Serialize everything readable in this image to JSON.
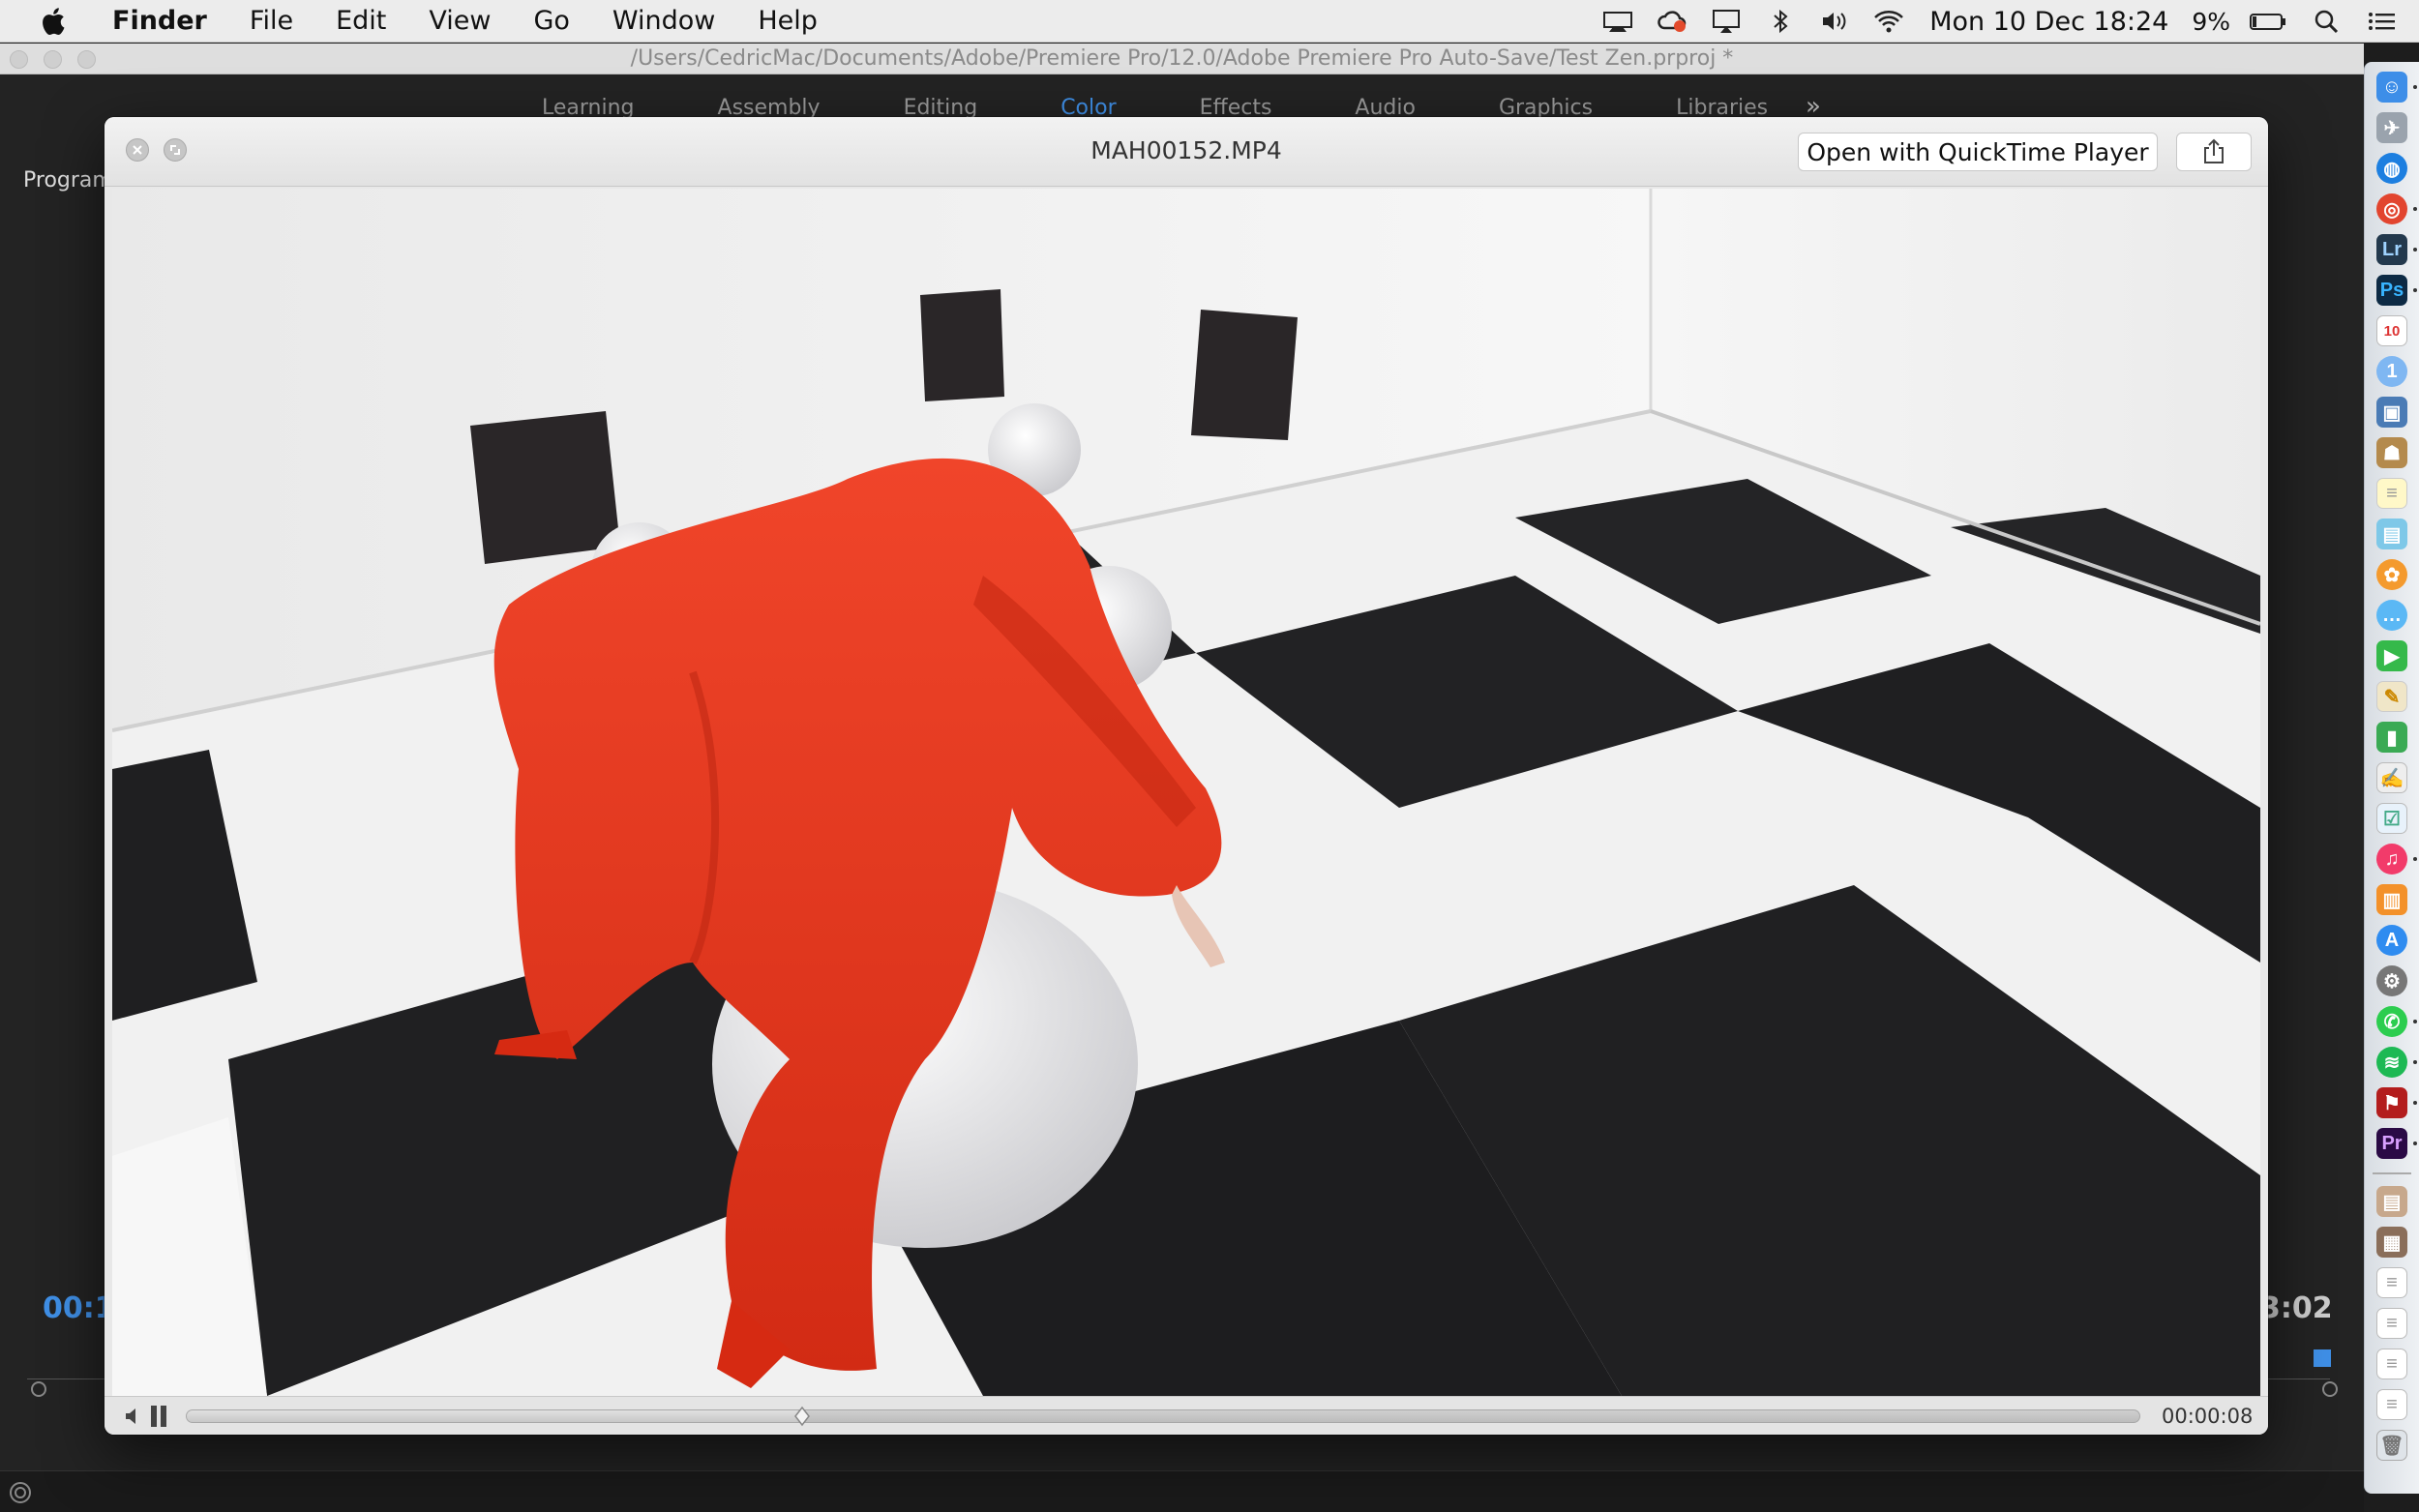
{
  "menubar": {
    "apple": "apple-icon",
    "app_name": "Finder",
    "items": [
      "File",
      "Edit",
      "View",
      "Go",
      "Window",
      "Help"
    ],
    "clock": "Mon 10 Dec  18:24",
    "battery": "9%"
  },
  "premiere": {
    "window_title": "/Users/CedricMac/Documents/Adobe/Premiere Pro/12.0/Adobe Premiere Pro Auto-Save/Test Zen.prproj *",
    "workspaces": [
      "Learning",
      "Assembly",
      "Editing",
      "Color",
      "Effects",
      "Audio",
      "Graphics",
      "Libraries"
    ],
    "active_workspace": "Color",
    "more": "»",
    "panel_label": "Program",
    "timecode_left": "00:1",
    "timecode_right": "3:02"
  },
  "quicklook": {
    "title": "MAH00152.MP4",
    "open_button": "Open with QuickTime Player",
    "time": "00:00:08",
    "progress": 0.315
  },
  "colors": {
    "accent": "#3f8fe6",
    "dress": "#e8331c"
  }
}
